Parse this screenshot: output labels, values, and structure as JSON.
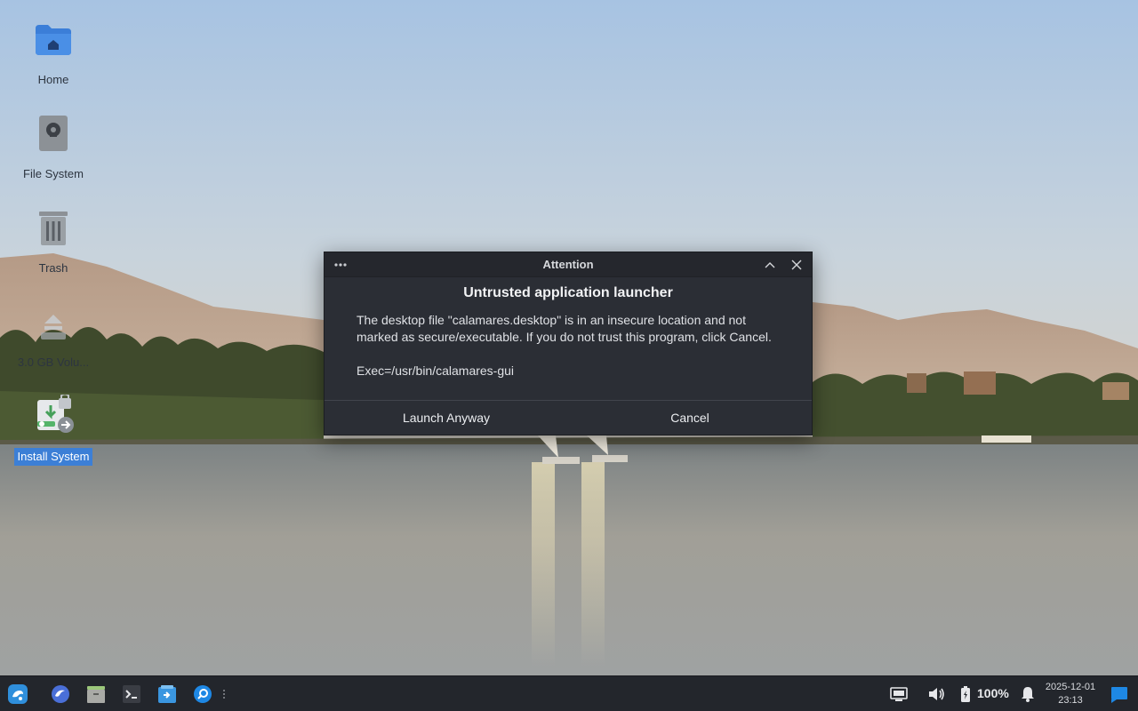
{
  "desktop": {
    "icons": [
      {
        "label": "Home",
        "icon": "home-folder-icon"
      },
      {
        "label": "File System",
        "icon": "drive-icon"
      },
      {
        "label": "Trash",
        "icon": "trash-icon"
      },
      {
        "label": "3.0 GB Volu...",
        "icon": "removable-volume-icon"
      },
      {
        "label": "Install System",
        "icon": "installer-icon",
        "selected": true
      }
    ]
  },
  "dialog": {
    "title": "Attention",
    "heading": "Untrusted application launcher",
    "message": "The desktop file \"calamares.desktop\" is in an insecure location and not marked as secure/executable. If you do not trust this program, click Cancel.",
    "exec": "Exec=/usr/bin/calamares-gui",
    "buttons": {
      "launch": "Launch Anyway",
      "cancel": "Cancel"
    }
  },
  "taskbar": {
    "launchers": [
      "start-menu-icon",
      "browser-icon",
      "file-manager-icon",
      "terminal-icon",
      "installer-launcher-icon",
      "search-icon"
    ],
    "tray": {
      "network_icon": "network-icon",
      "volume_icon": "volume-icon",
      "battery_icon": "battery-charging-icon",
      "battery_percent": "100%",
      "notification_icon": "bell-icon",
      "show_desktop_icon": "show-desktop-icon"
    },
    "clock": {
      "date": "2025-12-01",
      "time": "23:13"
    }
  },
  "colors": {
    "accent": "#3c7fd6",
    "dialog_bg": "#2b2e35",
    "taskbar_bg": "#23262c",
    "selection": "#3c7fd6"
  }
}
